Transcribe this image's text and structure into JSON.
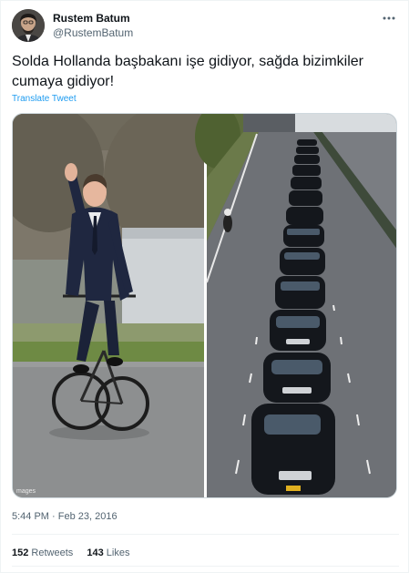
{
  "author": {
    "name": "Rustem Batum",
    "handle": "@RustemBatum"
  },
  "tweet": {
    "text": "Solda Hollanda başbakanı işe gidiyor, sağda bizimkiler cumaya gidiyor!",
    "translate_label": "Translate Tweet",
    "timestamp": "5:44 PM · Feb 23, 2016"
  },
  "media": {
    "watermark": "mages"
  },
  "stats": {
    "retweets_count": "152",
    "retweets_label": "Retweets",
    "likes_count": "143",
    "likes_label": "Likes"
  },
  "icons": {
    "more": "more-horizontal-icon"
  },
  "colors": {
    "link": "#1d9bf0",
    "secondary_text": "#536471",
    "primary_text": "#0f1419"
  }
}
